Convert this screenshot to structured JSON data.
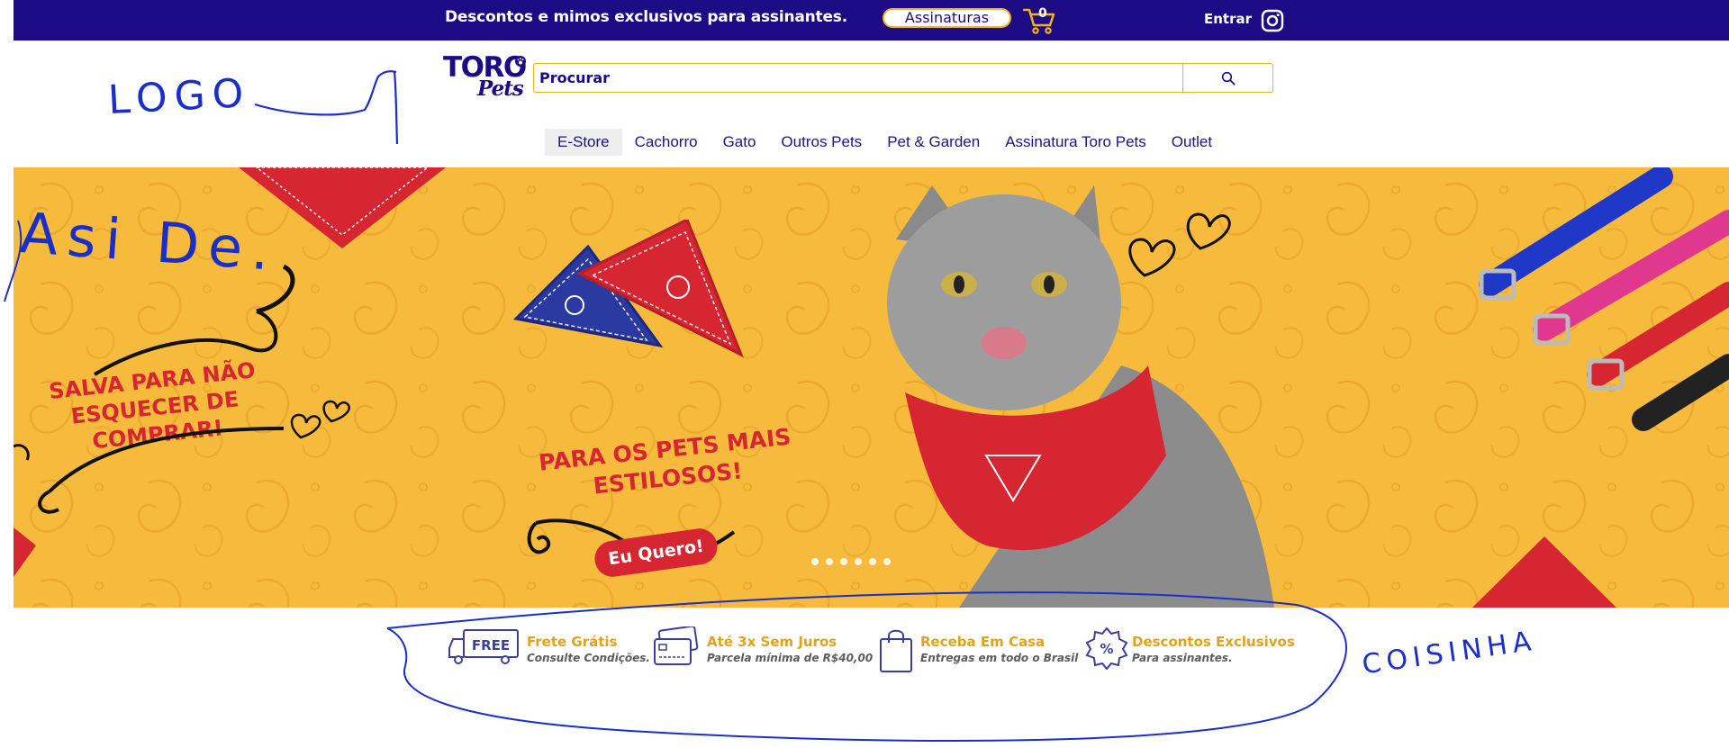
{
  "topbar": {
    "promo": "Descontos e mimos exclusivos para assinantes.",
    "subscribe_label": "Assinaturas",
    "cart_count": "0",
    "login_label": "Entrar"
  },
  "logo": {
    "line1": "TORO",
    "line2": "Pets"
  },
  "search": {
    "placeholder": "Procurar"
  },
  "nav": {
    "items": [
      {
        "label": "E-Store"
      },
      {
        "label": "Cachorro"
      },
      {
        "label": "Gato"
      },
      {
        "label": "Outros Pets"
      },
      {
        "label": "Pet & Garden"
      },
      {
        "label": "Assinatura Toro Pets"
      },
      {
        "label": "Outlet"
      }
    ]
  },
  "banner": {
    "left_line1": "SALVA PARA NÃO",
    "left_line2": "ESQUECER DE",
    "left_line3": "COMPRAR!",
    "center_line1": "PARA OS PETS MAIS",
    "center_line2": "ESTILOSOS!",
    "cta_label": "Eu Quero!",
    "slide_count": 6,
    "active_slide": 1
  },
  "features": [
    {
      "title": "Frete Grátis",
      "subtitle": "Consulte Condições.",
      "icon": "free-truck-icon",
      "icon_text": "FREE"
    },
    {
      "title": "Até 3x Sem Juros",
      "subtitle": "Parcela mínima de R$40,00",
      "icon": "credit-card-icon"
    },
    {
      "title": "Receba Em Casa",
      "subtitle": "Entregas em todo o Brasil",
      "icon": "shopping-bag-icon"
    },
    {
      "title": "Descontos Exclusivos",
      "subtitle": "Para assinantes.",
      "icon": "discount-badge-icon"
    }
  ],
  "annotations": {
    "logo": "LOGO",
    "aside": "Asi De.",
    "coisinha": "COISINHA"
  },
  "colors": {
    "topbar_bg": "#1d0a85",
    "accent_yellow": "#f4b418",
    "banner_bg": "#f6bb3c",
    "banner_red": "#d52631",
    "annotation_blue": "#1a2fc8"
  }
}
